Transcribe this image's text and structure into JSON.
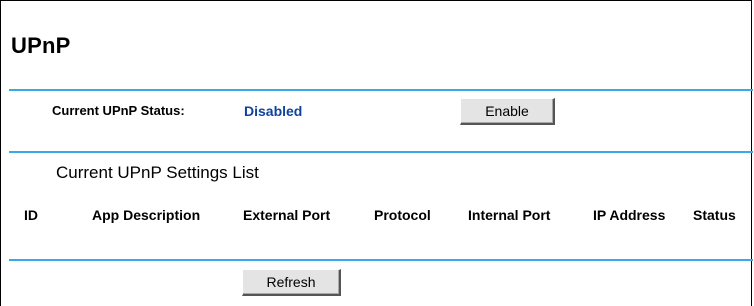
{
  "page": {
    "title": "UPnP"
  },
  "status": {
    "label": "Current UPnP Status:",
    "value": "Disabled",
    "value_color": "#10429c",
    "enable_button": "Enable"
  },
  "settings_list": {
    "heading": "Current UPnP Settings List",
    "columns": [
      "ID",
      "App Description",
      "External Port",
      "Protocol",
      "Internal Port",
      "IP Address",
      "Status"
    ],
    "rows": []
  },
  "actions": {
    "refresh_button": "Refresh"
  },
  "colors": {
    "divider": "#3aa9e8"
  }
}
